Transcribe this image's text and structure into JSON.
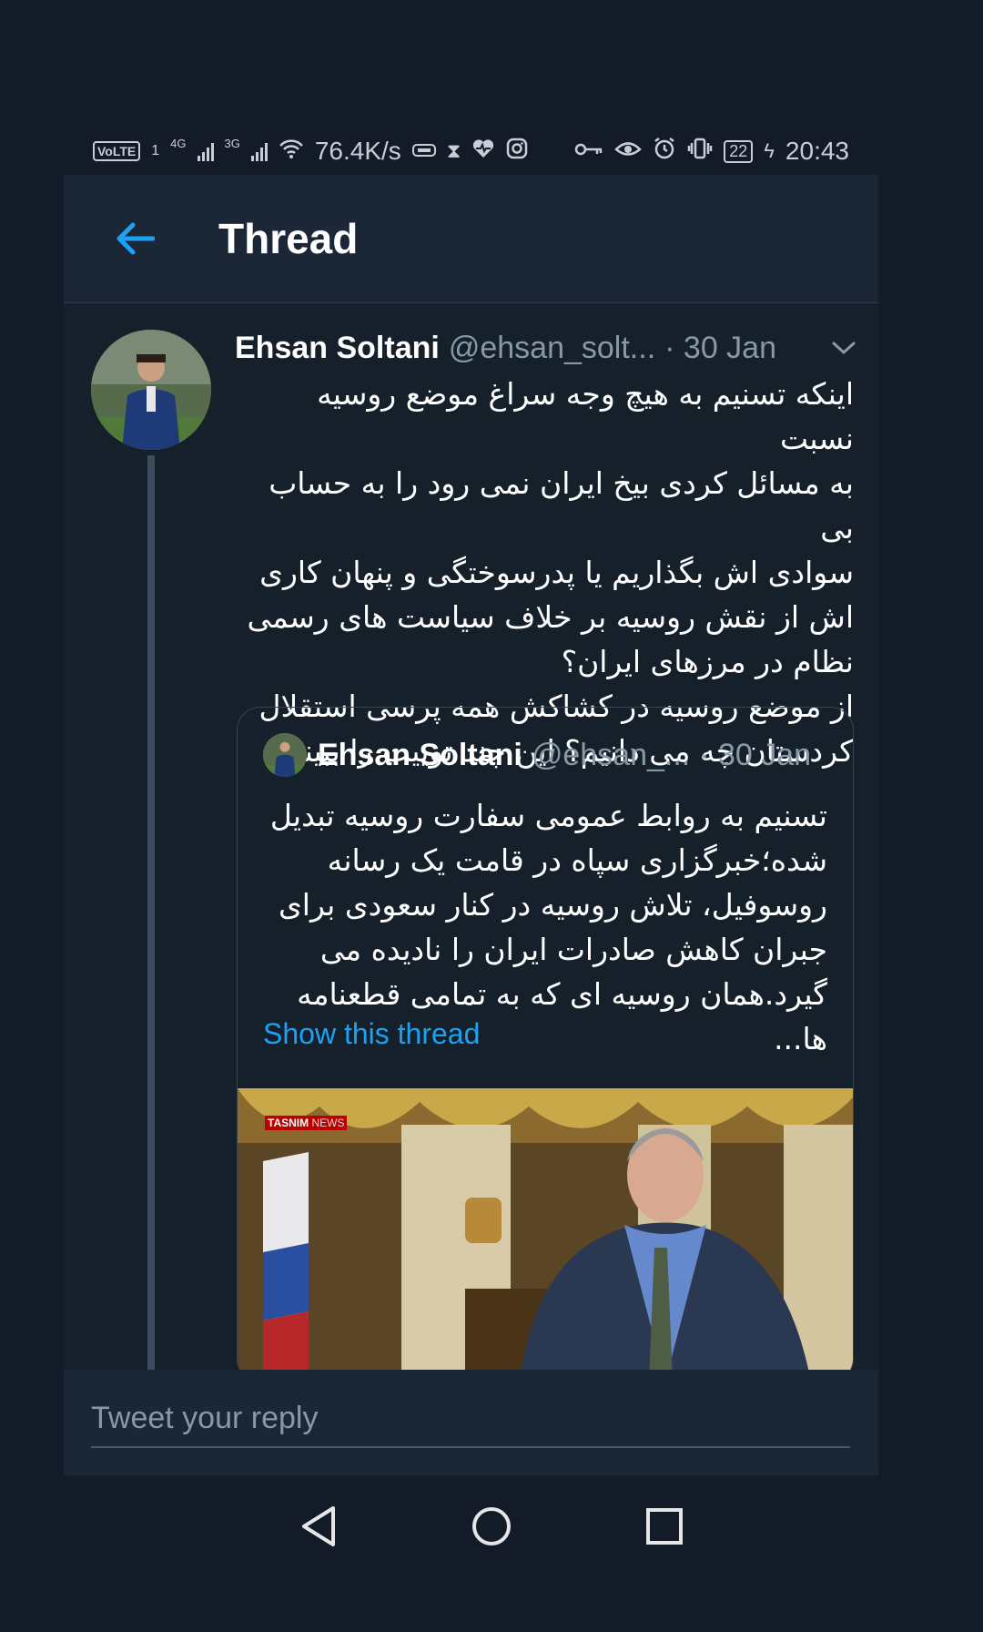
{
  "status_bar": {
    "volte": "VoLTE",
    "sim1": "1",
    "net1": "4G",
    "net2": "3G",
    "speed": "76.4K/s",
    "battery": "22",
    "time": "20:43"
  },
  "header": {
    "title": "Thread"
  },
  "tweet": {
    "name": "Ehsan Soltani",
    "handle": "@ehsan_solt...",
    "date": "· 30 Jan",
    "text": "اینکه تسنیم به هیچ وجه سراغ موضع روسیه نسبت\nبه مسائل کردی بیخ ایران نمی رود را به حساب بی\nسوادی اش بگذاریم یا پدرسوختگی و پنهان کاری\nاش از نقش روسیه بر خلاف سیاست های رسمی\nنظام در مرزهای ایران؟\nاز موضع روسیه در کشاکش همه پرسی استقلال\nکردستان چه می دانیم؟ این چند توییت را ببینید:"
  },
  "quoted_tweet": {
    "name": "Ehsan Soltani",
    "handle": "@ehsan_...",
    "date": "· 30 Jan",
    "text": "تسنیم به روابط عمومی سفارت روسیه تبدیل\nشده؛خبرگزاری سپاه در قامت یک رسانه\nروسوفیل، تلاش روسیه در کنار سعودی برای\nجبران کاهش صادرات ایران را نادیده می\nگیرد.همان روسیه ای که به تمامی قطعنامه ها...",
    "show_thread": "Show this thread",
    "image_watermark": "TASNIM",
    "image_watermark_sub": "NEWS"
  },
  "reply": {
    "placeholder": "Tweet your reply"
  },
  "colors": {
    "accent": "#1da1f2",
    "background": "#15202b",
    "muted": "#8899a6"
  },
  "icons": [
    "back-arrow-icon",
    "chevron-down-icon",
    "nav-back-icon",
    "nav-home-icon",
    "nav-recents-icon"
  ]
}
